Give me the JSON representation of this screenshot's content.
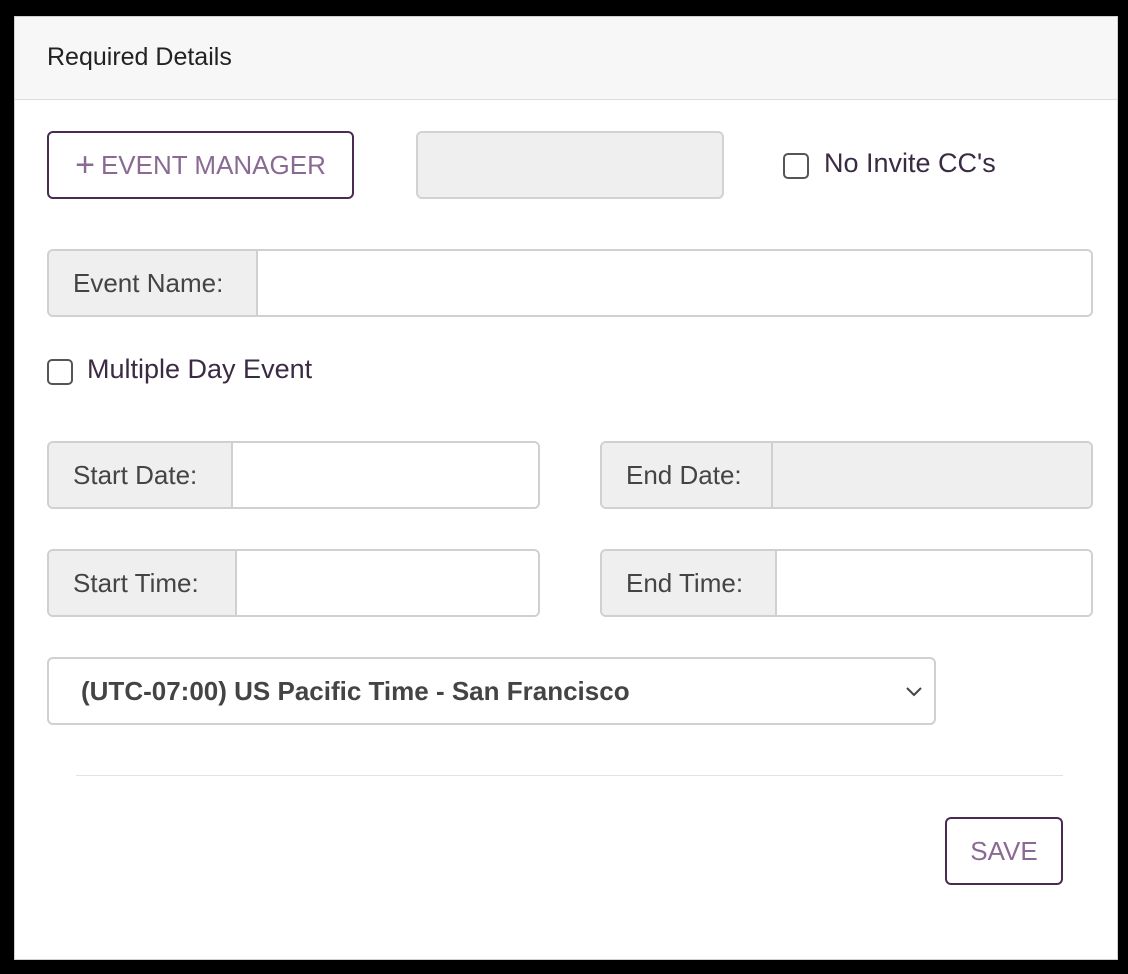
{
  "panel": {
    "title": "Required Details"
  },
  "event_manager": {
    "button_label": "EVENT MANAGER",
    "plus_icon": "+",
    "selected_value": ""
  },
  "no_invite_cc": {
    "label": "No Invite CC's",
    "checked": false
  },
  "event_name": {
    "label": "Event Name:",
    "value": ""
  },
  "multiple_day": {
    "label": "Multiple Day Event",
    "checked": false
  },
  "start_date": {
    "label": "Start Date:",
    "value": ""
  },
  "end_date": {
    "label": "End Date:",
    "value": "",
    "disabled": true
  },
  "start_time": {
    "label": "Start Time:",
    "value": ""
  },
  "end_time": {
    "label": "End Time:",
    "value": ""
  },
  "timezone": {
    "selected": "(UTC-07:00) US Pacific Time - San Francisco"
  },
  "actions": {
    "save_label": "SAVE"
  },
  "colors": {
    "accent_border": "#4a2c52",
    "accent_text": "#8a6a95",
    "addon_bg": "#efefef"
  },
  "icons": {
    "add": "plus-icon",
    "dropdown": "chevron-down-icon"
  }
}
